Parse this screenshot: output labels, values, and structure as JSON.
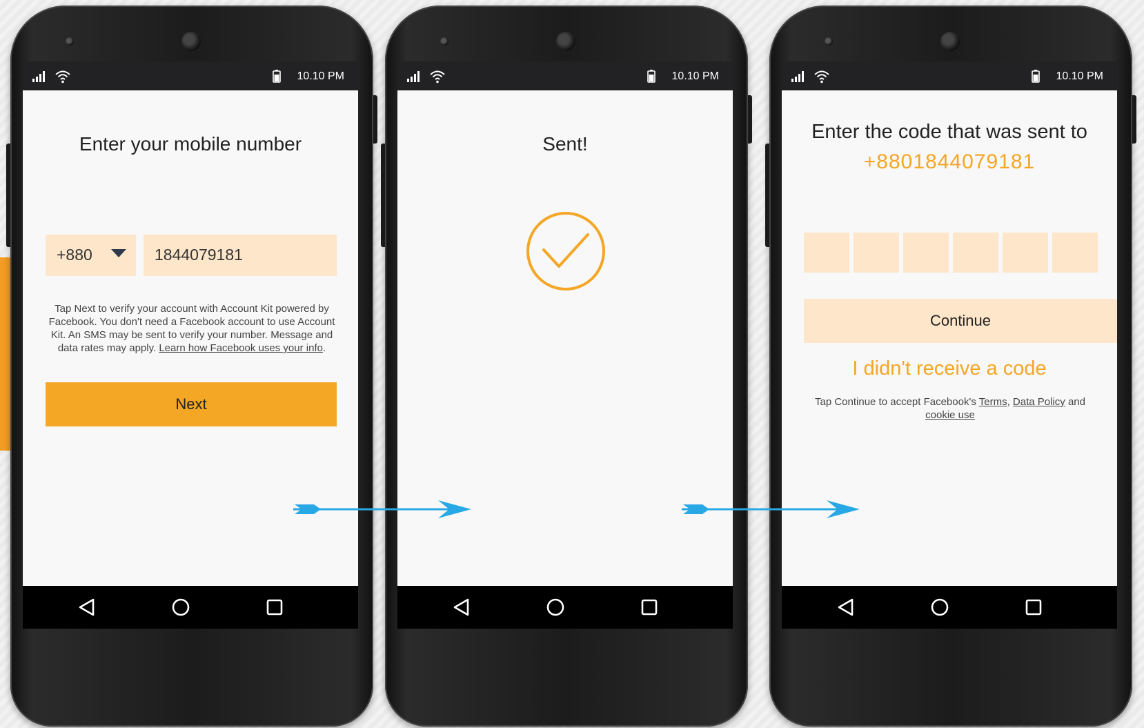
{
  "status": {
    "time": "10.10 PM"
  },
  "screen1": {
    "title": "Enter your mobile number",
    "country_code": "+880",
    "phone_number": "1844079181",
    "disclaimer_text": "Tap Next to verify your account with Account Kit powered by Facebook. You don't need a Facebook account to use Account Kit. An SMS may be sent to verify your number. Message and data rates may apply. ",
    "disclaimer_link": "Learn how Facebook uses your info",
    "disclaimer_end": ".",
    "next_label": "Next"
  },
  "screen2": {
    "title": "Sent!"
  },
  "screen3": {
    "title": "Enter the code that was sent to",
    "phone": "+8801844079181",
    "continue_label": "Continue",
    "resend_label": "I didn't receive a code",
    "terms_prefix": "Tap Continue to accept Facebook's ",
    "terms_link": "Terms",
    "terms_sep": ", ",
    "data_policy_link": "Data Policy",
    "terms_and": " and ",
    "cookie_link": "cookie use"
  },
  "colors": {
    "accent": "#f4a625",
    "input_fill": "#fde6c9",
    "arrow": "#29a8e6"
  },
  "icons": {
    "signal": "signal-icon",
    "wifi": "wifi-icon",
    "battery": "battery-icon",
    "back": "back-icon",
    "home": "home-icon",
    "recents": "recents-icon",
    "check": "checkmark-icon",
    "dropdown": "chevron-down-icon"
  }
}
